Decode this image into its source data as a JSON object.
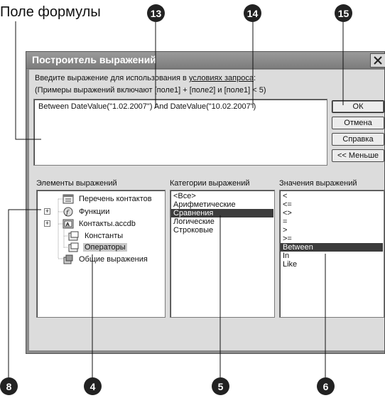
{
  "annotation": {
    "field_label": "Поле формулы",
    "badges": [
      "13",
      "14",
      "15",
      "8",
      "4",
      "5",
      "6"
    ]
  },
  "dialog": {
    "title": "Построитель выражений",
    "instruction_prefix": "Введите выражение для использования в ",
    "instruction_link": "условиях запроса",
    "instruction_suffix": ":",
    "instruction_line2": "(Примеры выражений включают [поле1] + [поле2] и [поле1] < 5)",
    "expression": "Between DateValue(\"1.02.2007\") And DateValue(\"10.02.2007\")",
    "buttons": {
      "ok": "ОК",
      "cancel": "Отмена",
      "help": "Справка",
      "less": "<< Меньше"
    },
    "elements": {
      "header": "Элементы выражений",
      "items": [
        "Перечень контактов",
        "Функции",
        "Контакты.accdb",
        "Константы",
        "Операторы",
        "Общие выражения"
      ]
    },
    "categories": {
      "header": "Категории выражений",
      "items": [
        "<Все>",
        "Арифметические",
        "Сравнения",
        "Логические",
        "Строковые"
      ],
      "selected": "Сравнения"
    },
    "values": {
      "header": "Значения выражений",
      "items": [
        "<",
        "<=",
        "<>",
        "=",
        ">",
        ">=",
        "Between",
        "In",
        "Like"
      ],
      "selected": "Between"
    }
  },
  "colors": {
    "badge": "#222222",
    "titlebar": "#8a8a8a",
    "dialog_face": "#dcdcdc",
    "selection": "#3c3c3c"
  }
}
